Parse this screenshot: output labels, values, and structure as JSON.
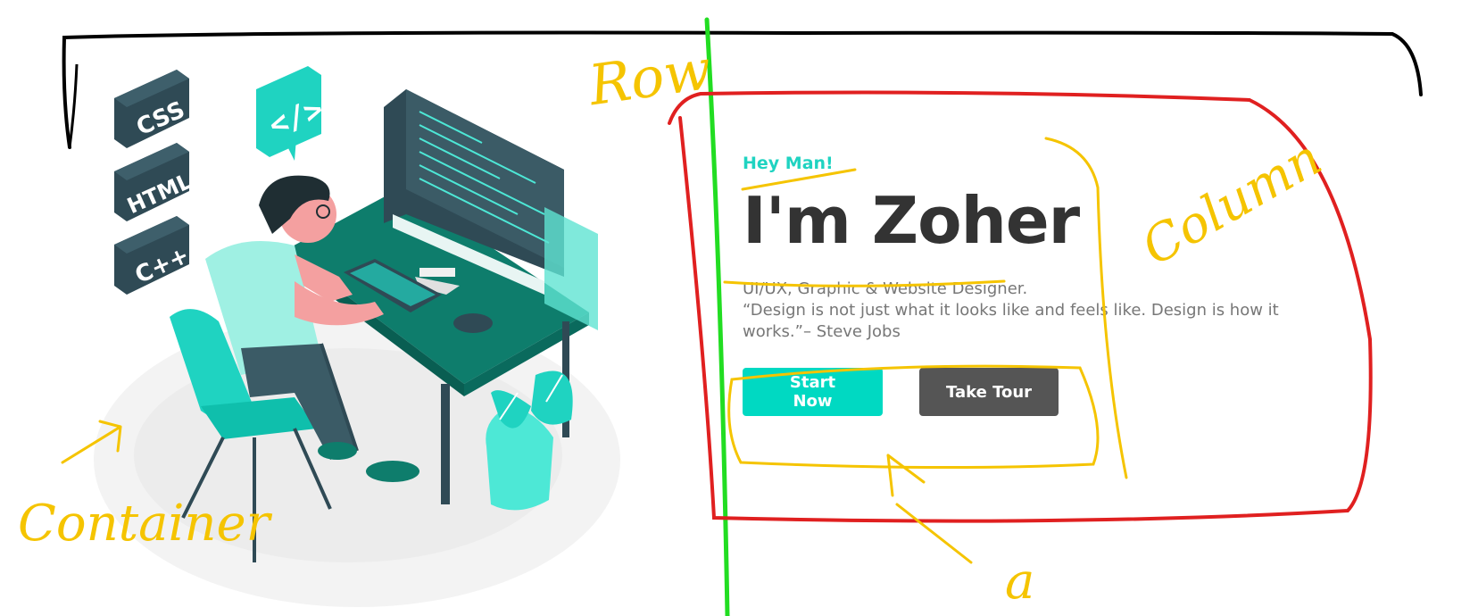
{
  "hero": {
    "greeting": "Hey Man!",
    "title": "I'm Zoher",
    "description_lines": [
      "UI/UX, Graphic & Website Designer.",
      "“Design is not just what it looks like and feels like. Design is how it works.”– Steve Jobs"
    ],
    "buttons": {
      "start_label": "Start Now",
      "tour_label": "Take Tour"
    }
  },
  "illustration": {
    "badges": [
      "CSS",
      "HTML",
      "C++"
    ],
    "code_bubble": "</>"
  },
  "annotations": {
    "row_label": "Row",
    "column_label": "Column",
    "container_label": "Container",
    "a_label": "a"
  },
  "colors": {
    "accent": "#00d9c2",
    "dark_button": "#555555",
    "title_text": "#333333",
    "body_text": "#777777",
    "annotation_yellow": "#f5c400",
    "annotation_red": "#e02020",
    "annotation_green": "#22dd22",
    "annotation_black": "#000000"
  }
}
